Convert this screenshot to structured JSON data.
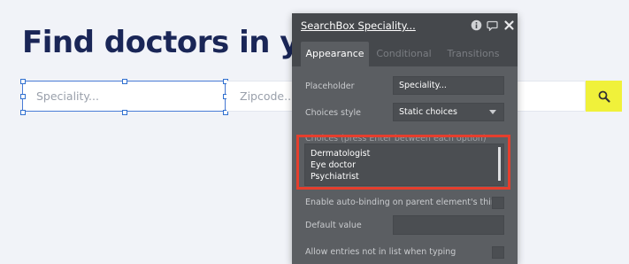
{
  "page": {
    "headline": "Find doctors in your",
    "speciality_placeholder": "Speciality...",
    "zipcode_placeholder": "Zipcode..."
  },
  "inspector": {
    "title": "SearchBox Speciality...",
    "tabs": [
      "Appearance",
      "Conditional",
      "Transitions"
    ],
    "placeholder_label": "Placeholder",
    "placeholder_value": "Speciality...",
    "choices_style_label": "Choices style",
    "choices_style_value": "Static choices",
    "choices_label": "Choices (press Enter between each option)",
    "choices": [
      "Dermatologist",
      "Eye doctor",
      "Psychiatrist"
    ],
    "auto_binding_label": "Enable auto-binding on parent element's thing",
    "default_value_label": "Default value",
    "default_value": "",
    "allow_entries_label": "Allow entries not in list when typing"
  },
  "colors": {
    "headline": "#1a2657",
    "search_button": "#f0f13a",
    "panel": "#5b5e62",
    "highlight": "#e53e2d"
  },
  "icons": {
    "search": "magnifier",
    "info": "info-circle",
    "comment": "speech-bubble",
    "close": "x"
  }
}
